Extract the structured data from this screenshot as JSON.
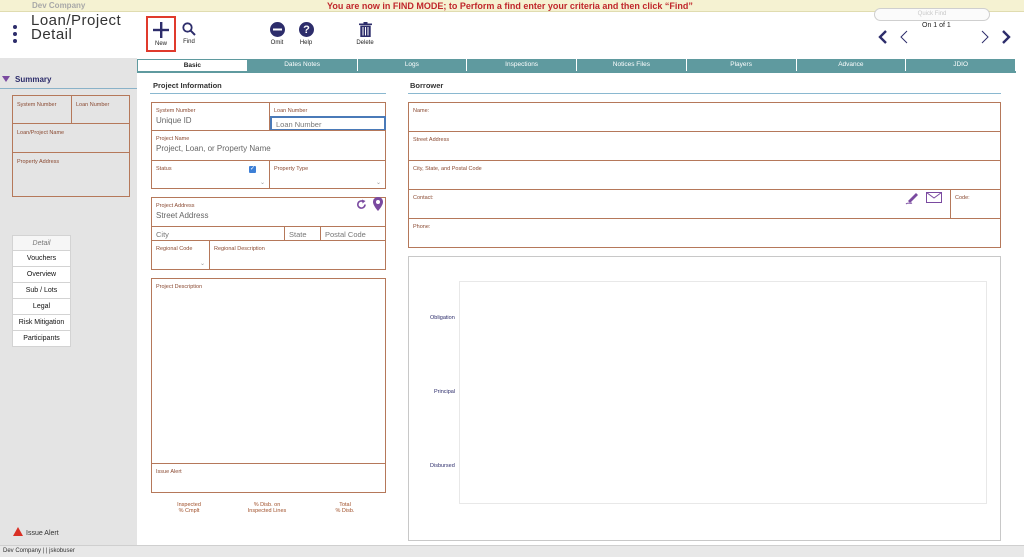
{
  "banner": {
    "company": "Dev Company",
    "find_message": "You are now in FIND MODE; to Perform a find enter your criteria and then click “Find”",
    "quick_find": "Quick Find"
  },
  "header": {
    "title_line1": "Loan/Project",
    "title_line2": "Detail",
    "tools": {
      "new": "New",
      "find": "Find",
      "omit": "Omit",
      "help": "Help",
      "delete": "Delete"
    },
    "record_status": "On 1 of 1"
  },
  "tabs": [
    "Basic",
    "Dates Notes",
    "Logs",
    "Inspections",
    "Notices Files",
    "Players",
    "Advance",
    "JDIO"
  ],
  "sidebar": {
    "summary_label": "Summary",
    "fields": {
      "system_number": "System Number",
      "loan_number": "Loan Number",
      "loan_project_name": "Loan/Project Name",
      "property_address": "Property Address"
    },
    "detail_header": "Detail",
    "detail_items": [
      "Vouchers",
      "Overview",
      "Sub / Lots",
      "Legal",
      "Risk Mitigation",
      "Participants"
    ],
    "issue_alert": "Issue Alert"
  },
  "project": {
    "title": "Project Information",
    "system_number_label": "System Number",
    "system_number_value": "Unique ID",
    "loan_number_label": "Loan Number",
    "loan_number_placeholder": "Loan Number",
    "project_name_label": "Project Name",
    "project_name_placeholder": "Project, Loan, or Property Name",
    "status_label": "Status",
    "property_type_label": "Property Type",
    "project_address_label": "Project Address",
    "street_placeholder": "Street Address",
    "city_placeholder": "City",
    "state_placeholder": "State",
    "postal_placeholder": "Postal Code",
    "regional_code_label": "Regional Code",
    "regional_description_label": "Regional Description",
    "project_description_label": "Project Description",
    "issue_alert_label": "Issue Alert",
    "stats": [
      {
        "line1": "Inspected",
        "line2": "% Cmplt"
      },
      {
        "line1": "% Disb. on",
        "line2": "Inspected Lines"
      },
      {
        "line1": "Total",
        "line2": "% Disb."
      }
    ]
  },
  "borrower": {
    "title": "Borrower",
    "name_label": "Name:",
    "street_label": "Street Address",
    "city_state_postal_label": "City, State, and Postal Code",
    "contact_label": "Contact:",
    "code_label": "Code:",
    "phone_label": "Phone:"
  },
  "chart": {
    "labels": [
      "Obligation",
      "Principal",
      "Disbursed"
    ]
  },
  "footer": {
    "text": "Dev Company |  | jskobuser"
  },
  "colors": {
    "tab_teal": "#5f9a9f",
    "field_border": "#b5785a",
    "alert_red": "#c0282c",
    "brand_navy": "#2d2d6b",
    "accent_purple": "#7a4aa0"
  }
}
